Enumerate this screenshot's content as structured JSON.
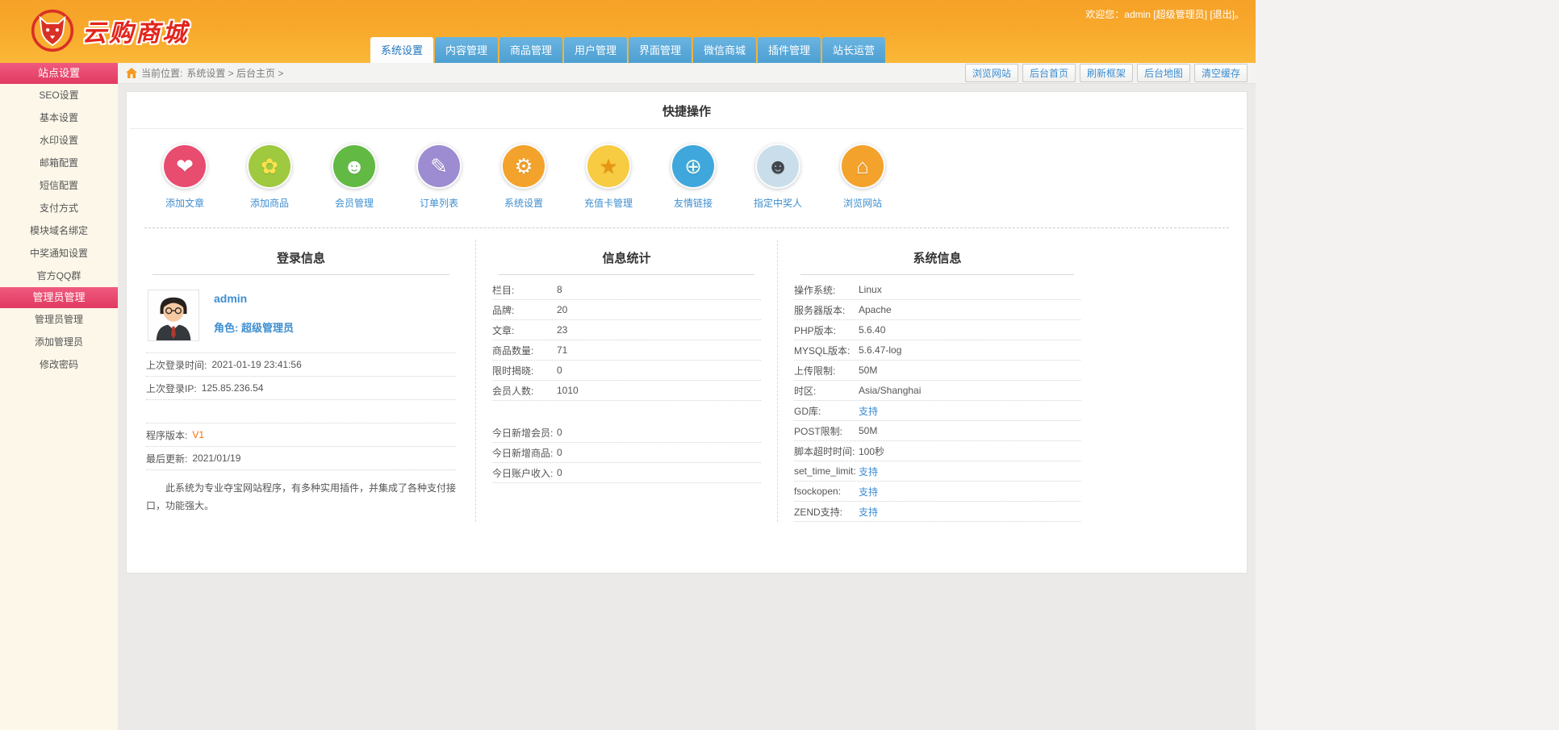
{
  "header": {
    "logo_text": "云购商城",
    "welcome": {
      "prefix": "欢迎您：",
      "username": "admin",
      "role": "[超级管理员]",
      "logout": "[退出]",
      "suffix": "。"
    }
  },
  "tabs": [
    {
      "label": "系统设置",
      "name": "system-settings",
      "active": true
    },
    {
      "label": "内容管理",
      "name": "content-management",
      "active": false
    },
    {
      "label": "商品管理",
      "name": "product-management",
      "active": false
    },
    {
      "label": "用户管理",
      "name": "user-management",
      "active": false
    },
    {
      "label": "界面管理",
      "name": "interface-management",
      "active": false
    },
    {
      "label": "微信商城",
      "name": "wechat-mall",
      "active": false
    },
    {
      "label": "插件管理",
      "name": "plugin-management",
      "active": false
    },
    {
      "label": "站长运营",
      "name": "webmaster-operations",
      "active": false
    }
  ],
  "breadcrumb": {
    "location_label": "当前位置:",
    "path": "系统设置 > 后台主页 >"
  },
  "toolbar": {
    "buttons": [
      {
        "label": "浏览网站",
        "name": "browse-site"
      },
      {
        "label": "后台首页",
        "name": "admin-home"
      },
      {
        "label": "刷新框架",
        "name": "refresh-frame"
      },
      {
        "label": "后台地图",
        "name": "admin-map"
      },
      {
        "label": "清空缓存",
        "name": "clear-cache"
      }
    ]
  },
  "sidebar": {
    "sections": [
      {
        "title": "站点设置",
        "name": "site-settings",
        "items": [
          {
            "label": "SEO设置",
            "name": "seo-settings"
          },
          {
            "label": "基本设置",
            "name": "basic-settings"
          },
          {
            "label": "水印设置",
            "name": "watermark-settings"
          },
          {
            "label": "邮箱配置",
            "name": "email-config"
          },
          {
            "label": "短信配置",
            "name": "sms-config"
          },
          {
            "label": "支付方式",
            "name": "payment-methods"
          },
          {
            "label": "模块域名绑定",
            "name": "module-domain-binding"
          },
          {
            "label": "中奖通知设置",
            "name": "winning-notice-settings"
          },
          {
            "label": "官方QQ群",
            "name": "official-qq-group"
          }
        ]
      },
      {
        "title": "管理员管理",
        "name": "admin-management",
        "items": [
          {
            "label": "管理员管理",
            "name": "admin-list"
          },
          {
            "label": "添加管理员",
            "name": "add-admin"
          },
          {
            "label": "修改密码",
            "name": "change-password"
          }
        ]
      }
    ]
  },
  "quick_actions": {
    "title": "快捷操作",
    "items": [
      {
        "label": "添加文章",
        "name": "add-article",
        "glyph": "❤",
        "bg": "#e84c6f",
        "glyph_color": "#ffffff"
      },
      {
        "label": "添加商品",
        "name": "add-product",
        "glyph": "✿",
        "bg": "#9fc93f",
        "glyph_color": "#ffe14d"
      },
      {
        "label": "会员管理",
        "name": "member-management",
        "glyph": "☻",
        "bg": "#62b944",
        "glyph_color": "#ffffff"
      },
      {
        "label": "订单列表",
        "name": "order-list",
        "glyph": "✎",
        "bg": "#9d8cd2",
        "glyph_color": "#ffffff"
      },
      {
        "label": "系统设置",
        "name": "system-settings",
        "glyph": "⚙",
        "bg": "#f3a22b",
        "glyph_color": "#ffffff"
      },
      {
        "label": "充值卡管理",
        "name": "recharge-card-management",
        "glyph": "★",
        "bg": "#f7cb42",
        "glyph_color": "#e8960f"
      },
      {
        "label": "友情链接",
        "name": "friendly-links",
        "glyph": "⊕",
        "bg": "#3fa7dc",
        "glyph_color": "#eafaf0"
      },
      {
        "label": "指定中奖人",
        "name": "assign-winner",
        "glyph": "☻",
        "bg": "#c9deea",
        "glyph_color": "#41474d"
      },
      {
        "label": "浏览网站",
        "name": "browse-website",
        "glyph": "⌂",
        "bg": "#f3a22b",
        "glyph_color": "#ffffff"
      }
    ]
  },
  "login_info": {
    "title": "登录信息",
    "username": "admin",
    "role_label": "角色:",
    "role": "超级管理员",
    "rows": [
      {
        "label": "上次登录时间:",
        "value": "2021-01-19 23:41:56"
      },
      {
        "label": "上次登录IP:",
        "value": "125.85.236.54"
      },
      {
        "label": "",
        "value": ""
      }
    ],
    "version_label": "程序版本:",
    "version": "V1",
    "updated_label": "最后更新:",
    "updated": "2021/01/19",
    "description": "此系统为专业夺宝网站程序，有多种实用插件，并集成了各种支付接口，功能强大。"
  },
  "stats": {
    "title": "信息统计",
    "groups": [
      [
        {
          "label": "栏目:",
          "value": "8"
        },
        {
          "label": "品牌:",
          "value": "20"
        },
        {
          "label": "文章:",
          "value": "23"
        },
        {
          "label": "商品数量:",
          "value": "71"
        },
        {
          "label": "限时揭晓:",
          "value": "0"
        },
        {
          "label": "会员人数:",
          "value": "1010"
        }
      ],
      [
        {
          "label": "今日新增会员:",
          "value": "0"
        },
        {
          "label": "今日新增商品:",
          "value": "0"
        },
        {
          "label": "今日账户收入:",
          "value": "0"
        }
      ]
    ]
  },
  "system_info": {
    "title": "系统信息",
    "rows": [
      {
        "label": "操作系统:",
        "value": "Linux",
        "link": false
      },
      {
        "label": "服务器版本:",
        "value": "Apache",
        "link": false
      },
      {
        "label": "PHP版本:",
        "value": "5.6.40",
        "link": false
      },
      {
        "label": "MYSQL版本:",
        "value": "5.6.47-log",
        "link": false
      },
      {
        "label": "上传限制:",
        "value": "50M",
        "link": false
      },
      {
        "label": "时区:",
        "value": "Asia/Shanghai",
        "link": false
      },
      {
        "label": "GD库:",
        "value": "支持",
        "link": true
      },
      {
        "label": "POST限制:",
        "value": "50M",
        "link": false
      },
      {
        "label": "脚本超时时间:",
        "value": "100秒",
        "link": false
      },
      {
        "label": "set_time_limit:",
        "value": "支持",
        "link": true
      },
      {
        "label": "fsockopen:",
        "value": "支持",
        "link": true
      },
      {
        "label": "ZEND支持:",
        "value": "支持",
        "link": true
      }
    ]
  }
}
